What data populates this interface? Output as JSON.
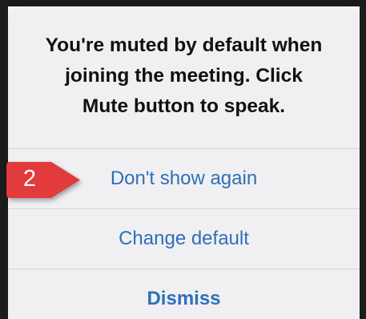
{
  "dialog": {
    "message": "You're muted by default when\njoining the meeting. Click\nMute button to speak.",
    "actions": [
      {
        "label": "Don't show again"
      },
      {
        "label": "Change default"
      },
      {
        "label": "Dismiss"
      }
    ]
  },
  "callout": {
    "number": "2",
    "color": "#e23b3b"
  },
  "colors": {
    "action_text": "#2f6fb8",
    "dialog_bg": "#f0f0f2"
  }
}
